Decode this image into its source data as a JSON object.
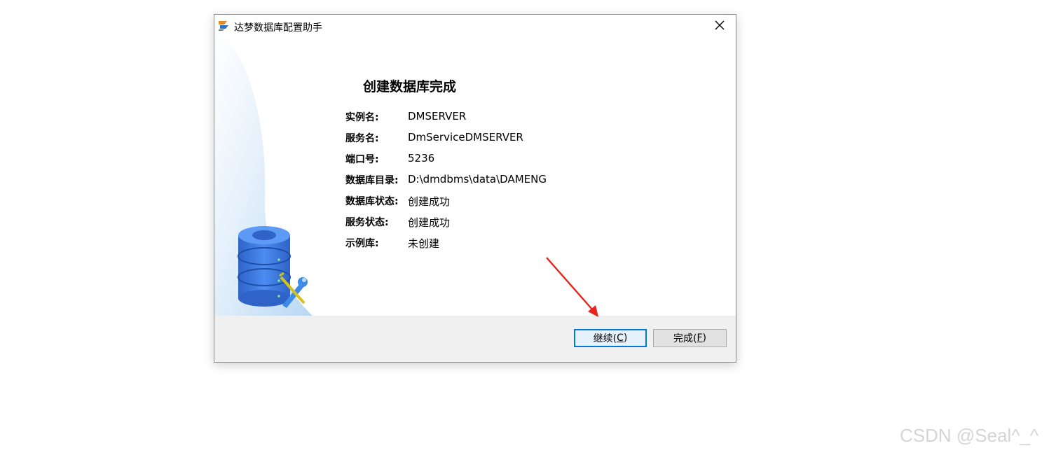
{
  "window": {
    "title": "达梦数据库配置助手",
    "close_symbol": "✕"
  },
  "main": {
    "heading": "创建数据库完成",
    "fields": [
      {
        "label": "实例名:",
        "value": "DMSERVER"
      },
      {
        "label": "服务名:",
        "value": "DmServiceDMSERVER"
      },
      {
        "label": "端口号:",
        "value": "5236"
      },
      {
        "label": "数据库目录:",
        "value": "D:\\dmdbms\\data\\DAMENG"
      },
      {
        "label": "数据库状态:",
        "value": "创建成功"
      },
      {
        "label": "服务状态:",
        "value": "创建成功"
      },
      {
        "label": "示例库:",
        "value": "未创建"
      }
    ]
  },
  "buttons": {
    "continue_text": "继续(",
    "continue_key": "C",
    "continue_end": ")",
    "finish_text": "完成(",
    "finish_key": "F",
    "finish_end": ")"
  },
  "watermark": "CSDN @Seal^_^",
  "colors": {
    "accent": "#0078d7",
    "footer_bg": "#f0f0f0",
    "db_blue": "#3a78d8",
    "arrow_red": "#e8231d"
  },
  "icons": [
    "app-icon",
    "close-icon",
    "database-icon",
    "wrench-icon",
    "red-arrow"
  ]
}
